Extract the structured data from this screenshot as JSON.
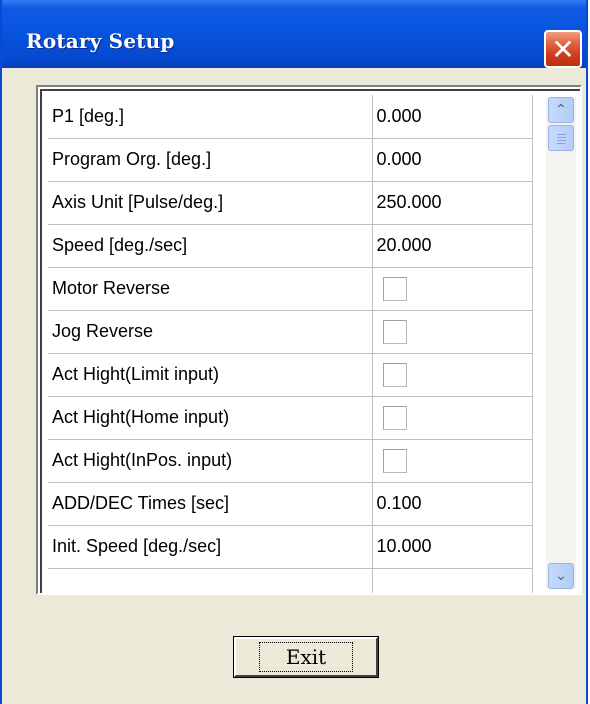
{
  "window": {
    "title": "Rotary Setup",
    "close_glyph": "✕"
  },
  "grid": {
    "rows": [
      {
        "label": "P1 [deg.]",
        "type": "text",
        "value": "0.000"
      },
      {
        "label": "Program Org. [deg.]",
        "type": "text",
        "value": "0.000"
      },
      {
        "label": "Axis Unit [Pulse/deg.]",
        "type": "text",
        "value": "250.000"
      },
      {
        "label": "Speed [deg./sec]",
        "type": "text",
        "value": "20.000"
      },
      {
        "label": "Motor Reverse",
        "type": "checkbox",
        "checked": false
      },
      {
        "label": "Jog Reverse",
        "type": "checkbox",
        "checked": false
      },
      {
        "label": "Act Hight(Limit input)",
        "type": "checkbox",
        "checked": false
      },
      {
        "label": "Act Hight(Home input)",
        "type": "checkbox",
        "checked": false
      },
      {
        "label": "Act Hight(InPos. input)",
        "type": "checkbox",
        "checked": false
      },
      {
        "label": "ADD/DEC Times [sec]",
        "type": "text",
        "value": "0.100"
      },
      {
        "label": "Init. Speed [deg./sec]",
        "type": "text",
        "value": "10.000"
      },
      {
        "label": "",
        "type": "text",
        "value": ""
      }
    ]
  },
  "scrollbar": {
    "up_glyph": "⌃",
    "down_glyph": "⌄"
  },
  "footer": {
    "exit_label": "Exit"
  },
  "colors": {
    "titlebar": "#0753dd",
    "close": "#cc3a1c",
    "dialog_bg": "#ece9d8"
  }
}
